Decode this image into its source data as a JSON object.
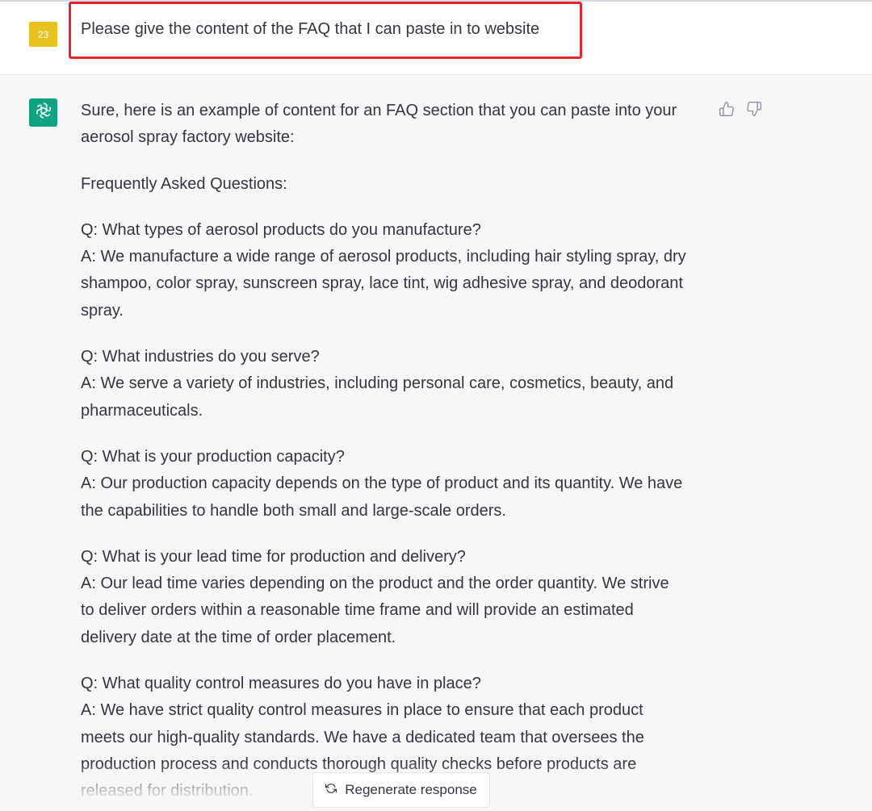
{
  "user_message": {
    "avatar_text": "23",
    "text": "Please give the content of the FAQ that I can paste in to website"
  },
  "assistant_message": {
    "paragraphs": [
      {
        "lines": [
          "Sure, here is an example of content for an FAQ section that you can paste into your",
          "aerosol spray factory website:"
        ]
      },
      {
        "lines": [
          "Frequently Asked Questions:"
        ]
      },
      {
        "lines": [
          "Q: What types of aerosol products do you manufacture?",
          "A: We manufacture a wide range of aerosol products, including hair styling spray, dry",
          "shampoo, color spray, sunscreen spray, lace tint, wig adhesive spray, and deodorant",
          "spray."
        ]
      },
      {
        "lines": [
          "Q: What industries do you serve?",
          "A: We serve a variety of industries, including personal care, cosmetics, beauty, and",
          "pharmaceuticals."
        ]
      },
      {
        "lines": [
          "Q: What is your production capacity?",
          "A: Our production capacity depends on the type of product and its quantity. We have",
          "the capabilities to handle both small and large-scale orders."
        ]
      },
      {
        "lines": [
          "Q: What is your lead time for production and delivery?",
          "A: Our lead time varies depending on the product and the order quantity. We strive",
          "to deliver orders within a reasonable time frame and will provide an estimated",
          "delivery date at the time of order placement."
        ]
      },
      {
        "lines": [
          "Q: What quality control measures do you have in place?",
          "A: We have strict quality control measures in place to ensure that each product",
          "meets our high-quality standards. We have a dedicated team that oversees the",
          "production process and conducts thorough quality checks before products are",
          "released for distribution."
        ]
      }
    ]
  },
  "regenerate": {
    "label": "Regenerate response",
    "icon": "refresh-icon"
  },
  "feedback": {
    "thumbs_up_icon": "thumbs-up-icon",
    "thumbs_down_icon": "thumbs-down-icon"
  },
  "colors": {
    "user_avatar": "#e8c31f",
    "assistant_avatar": "#10a37f",
    "highlight_border": "#e0252b",
    "assistant_background": "#f7f7f8",
    "text": "#343541"
  }
}
